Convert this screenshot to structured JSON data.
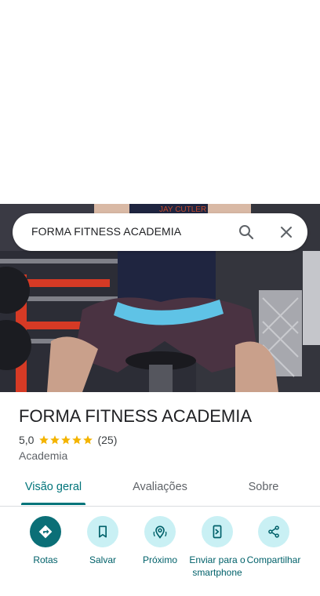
{
  "search": {
    "query": "FORMA FITNESS ACADEMIA",
    "search_icon": "search-icon",
    "close_icon": "close-icon"
  },
  "photo": {
    "shirt_text": "JAY CUTLER"
  },
  "place": {
    "title": "FORMA FITNESS ACADEMIA",
    "rating": "5,0",
    "stars": 5,
    "star_color": "#f4b400",
    "review_count": "(25)",
    "category": "Academia"
  },
  "tabs": [
    {
      "label": "Visão geral",
      "active": true
    },
    {
      "label": "Avaliações",
      "active": false
    },
    {
      "label": "Sobre",
      "active": false
    }
  ],
  "actions": [
    {
      "label": "Rotas",
      "icon": "directions-icon"
    },
    {
      "label": "Salvar",
      "icon": "bookmark-icon"
    },
    {
      "label": "Próximo",
      "icon": "nearby-icon"
    },
    {
      "label": "Enviar para o smartphone",
      "icon": "send-to-phone-icon"
    },
    {
      "label": "Compartilhar",
      "icon": "share-icon"
    }
  ],
  "colors": {
    "accent": "#00747a",
    "primary_button": "#0b6f77",
    "secondary_button": "#c9f0f4"
  }
}
